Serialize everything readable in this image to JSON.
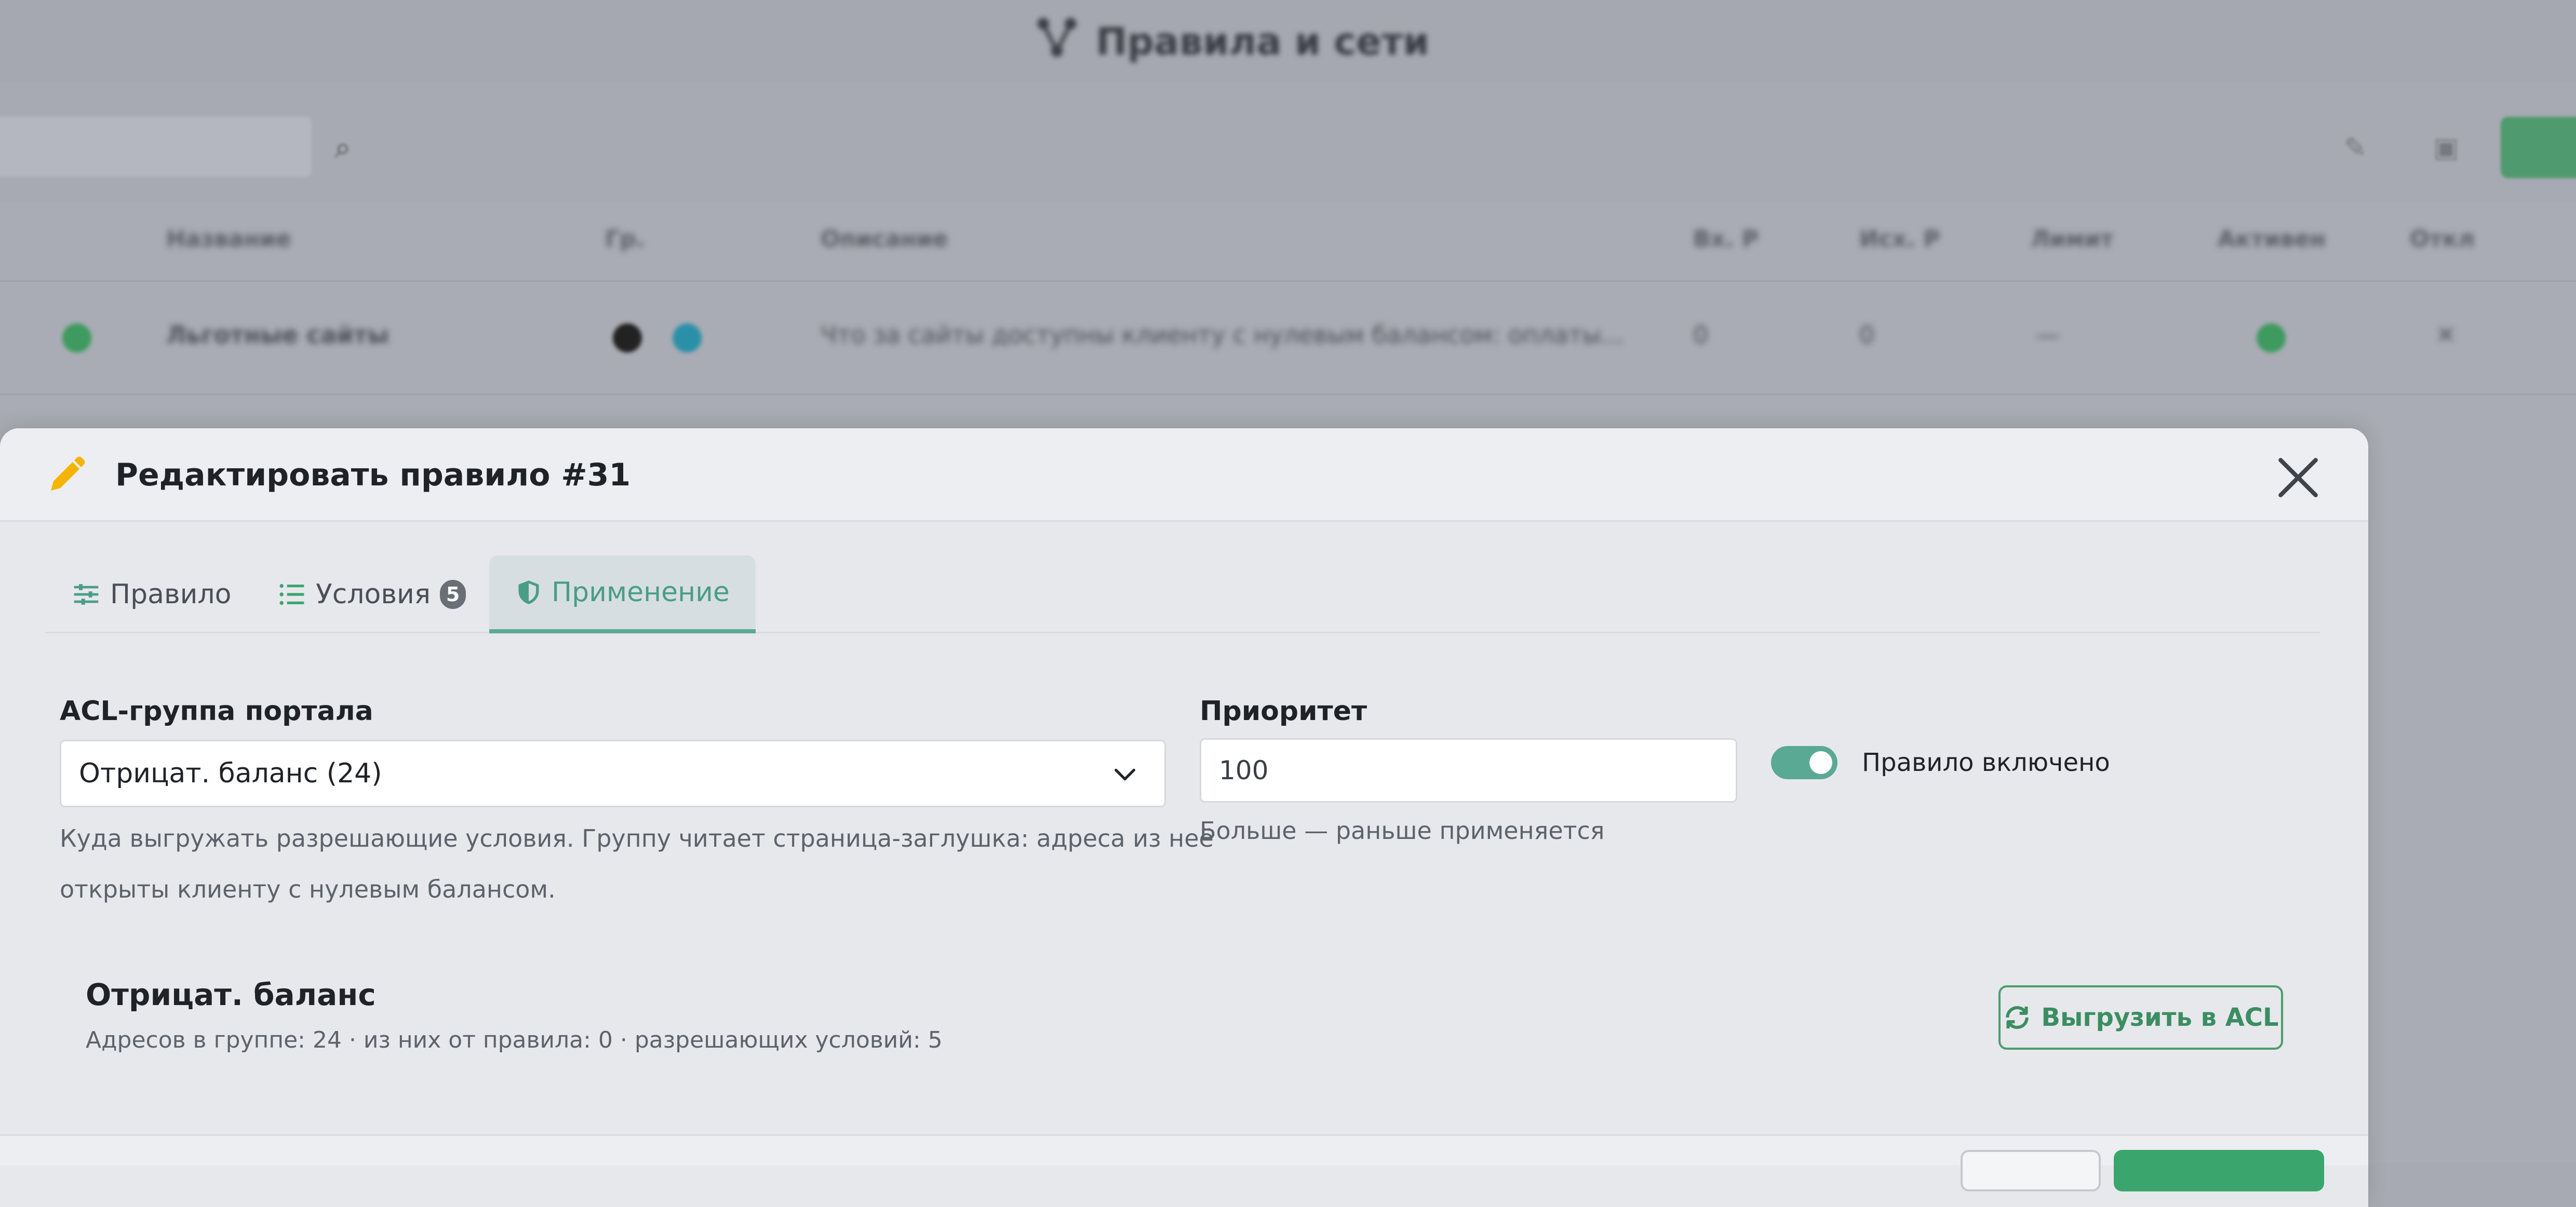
{
  "background": {
    "app_title": "Правила и сети",
    "table_headers": [
      "Название",
      "Гр.",
      "Описание",
      "Вх. P",
      "Исх. P",
      "Лимит",
      "Активен",
      "Откл"
    ],
    "first_row": {
      "name": "Льготные сайты",
      "description": "Что за сайты доступны клиенту с нулевым балансом: оплаты...",
      "in_p": "0",
      "out_p": "0",
      "limit": "—"
    }
  },
  "modal": {
    "title": "Редактировать правило #31",
    "tabs": [
      {
        "label": "Правило",
        "icon": "sliders-icon"
      },
      {
        "label": "Условия",
        "icon": "list-icon",
        "badge": "5"
      },
      {
        "label": "Применение",
        "icon": "shield-icon",
        "active": true
      }
    ],
    "acl": {
      "label": "ACL-группа портала",
      "selected": "Отрицат. баланс (24)",
      "help_line1": "Куда выгружать разрешающие условия. Группу читает страница-заглушка: адреса из неё",
      "help_line2": "открыты клиенту с нулевым балансом."
    },
    "priority": {
      "label": "Приоритет",
      "value": "100",
      "help": "Больше — раньше применяется"
    },
    "toggle": {
      "label": "Правило включено",
      "on": true
    },
    "summary": {
      "title": "Отрицат. баланс",
      "stats": "Адресов в группе: 24 · из них от правила: 0 · разрешающих условий: 5",
      "export_label": "Выгрузить в ACL"
    }
  },
  "colors": {
    "accent": "#5aa994",
    "primary_green": "#3aa56d",
    "pencil": "#f5b400"
  }
}
